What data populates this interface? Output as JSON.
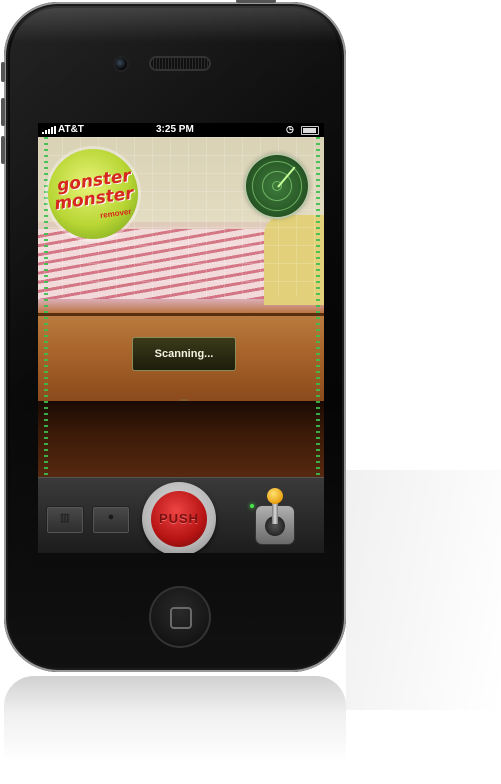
{
  "status_bar": {
    "carrier": "AT&T",
    "time": "3:25 PM",
    "alarm_icon": "clock-icon",
    "battery_icon": "battery-icon",
    "signal_icon": "signal-bars-icon"
  },
  "app": {
    "logo": {
      "line1": "gonster",
      "line2": "monster",
      "line3": "remover"
    },
    "radar_icon": "radar-icon",
    "scan_status": "Scanning...",
    "scan_indicator_color": "#3bbf4f"
  },
  "toolbar": {
    "left_button_1": {
      "icon": "waveform-icon",
      "label": ""
    },
    "left_button_2": {
      "icon": "info-icon",
      "label": ""
    },
    "push_label": "PUSH",
    "push_color": "#b71414",
    "led_color": "#45e34a",
    "joystick_icon": "joystick-icon"
  },
  "device": {
    "home_button_icon": "home-square-icon"
  }
}
